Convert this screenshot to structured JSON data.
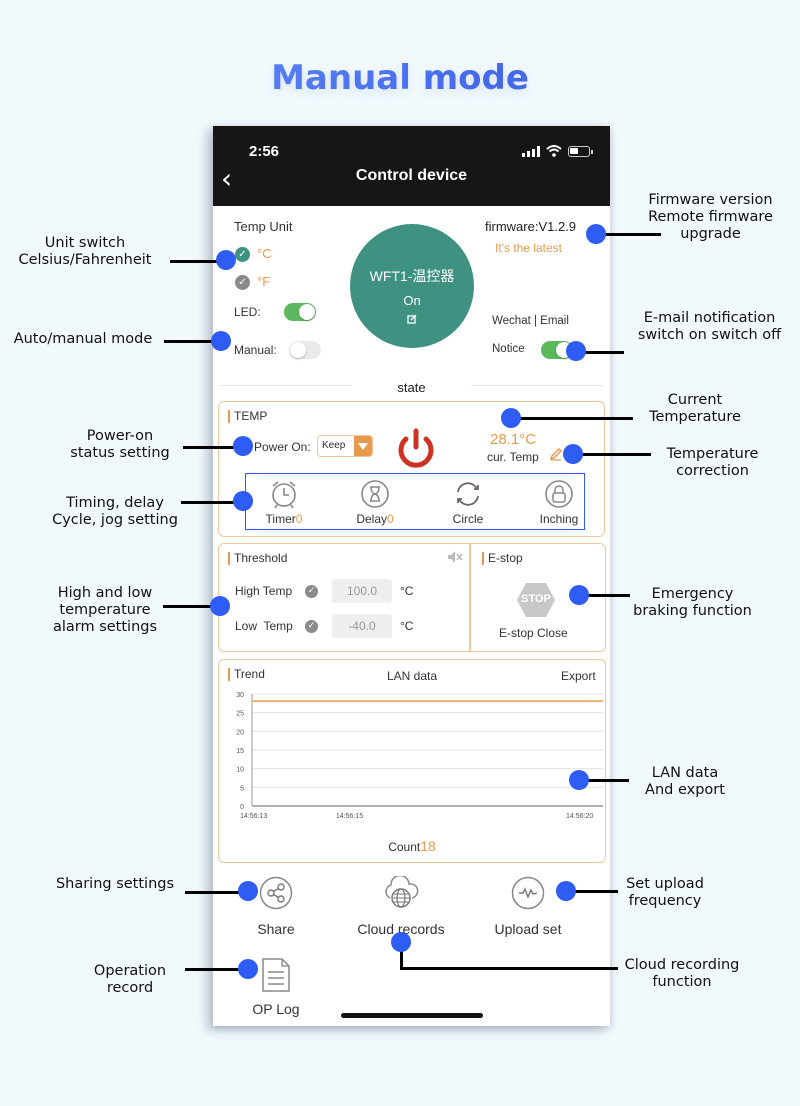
{
  "headline": "Manual mode",
  "status_bar": {
    "time": "2:56"
  },
  "nav": {
    "back_icon": "chevron-left-icon",
    "title": "Control device"
  },
  "device": {
    "temp_unit_label": "Temp Unit",
    "units": [
      {
        "label": "°C",
        "selected": true
      },
      {
        "label": "°F",
        "selected": false
      }
    ],
    "led_label": "LED:",
    "led_on": true,
    "manual_label": "Manual:",
    "manual_on": false,
    "name": "WFT1-温控器",
    "state": "On",
    "edit_icon": "edit-icon",
    "firmware": "firmware:V1.2.9",
    "firmware_status": "It's the latest",
    "notify_channels": "Wechat | Email",
    "notice_label": "Notice",
    "notice_on": true,
    "section_label": "state"
  },
  "temp_card": {
    "title": "TEMP",
    "power_on_label": "Power On:",
    "power_on_value": "Keep",
    "current_temp": "28.1°C",
    "cur_temp_label": "cur. Temp",
    "functions": [
      {
        "label": "Timer",
        "count": "0",
        "icon": "alarm-clock-icon"
      },
      {
        "label": "Delay",
        "count": "0",
        "icon": "hourglass-icon"
      },
      {
        "label": "Circle",
        "count": "",
        "icon": "cycle-icon"
      },
      {
        "label": "Inching",
        "count": "",
        "icon": "lock-icon"
      }
    ]
  },
  "threshold_card": {
    "title": "Threshold",
    "high_label": "High Temp",
    "high_value": "100.0",
    "low_label": "Low  Temp",
    "low_value": "-40.0",
    "unit": "°C"
  },
  "estop_card": {
    "title": "E-stop",
    "stop_text": "STOP",
    "status": "E-stop Close"
  },
  "trend_card": {
    "title": "Trend",
    "center_label": "LAN data",
    "export_label": "Export",
    "count_label": "Count",
    "count_value": "18"
  },
  "chart_data": {
    "type": "line",
    "title": "Trend",
    "xlabel": "",
    "ylabel": "",
    "ylim": [
      0,
      30
    ],
    "yticks": [
      0,
      5,
      10,
      15,
      20,
      25,
      30
    ],
    "x_tick_labels": [
      "14:56:13",
      "14:56:15",
      "14:56:20"
    ],
    "x_tick_positions_sec": [
      0,
      2,
      7
    ],
    "x_range_sec": [
      0,
      7.2
    ],
    "grid": true,
    "series": [
      {
        "name": "Temperature",
        "color": "#e8994e",
        "x": [
          0,
          7.2
        ],
        "y": [
          28.1,
          28.1
        ]
      }
    ]
  },
  "bottom_actions": [
    {
      "label": "Share",
      "icon": "share-icon"
    },
    {
      "label": "Cloud records",
      "icon": "cloud-globe-icon"
    },
    {
      "label": "Upload set",
      "icon": "pulse-icon"
    },
    {
      "label": "OP Log",
      "icon": "document-icon"
    }
  ],
  "annotations": {
    "unit_switch": "Unit switch\nCelsius/Fahrenheit",
    "auto_manual": "Auto/manual mode",
    "power_on": "Power-on\nstatus setting",
    "timing": "Timing, delay\nCycle, jog setting",
    "high_low": "High and low\ntemperature\nalarm settings",
    "sharing": "Sharing settings",
    "operation": "Operation\nrecord",
    "firmware": "Firmware version\nRemote firmware\nupgrade",
    "email": "E-mail notification\nswitch on switch off",
    "current_temp": "Current\nTemperature",
    "correction": "Temperature\ncorrection",
    "emergency": "Emergency\nbraking function",
    "lan": "LAN data\nAnd export",
    "upload": "Set upload\nfrequency",
    "cloud": "Cloud recording\nfunction"
  },
  "colors": {
    "accent_orange": "#e8994e",
    "device_green": "#3f9282",
    "toggle_green": "#5cb85c",
    "power_red": "#cc3322",
    "marker_blue": "#2f5cf5"
  }
}
